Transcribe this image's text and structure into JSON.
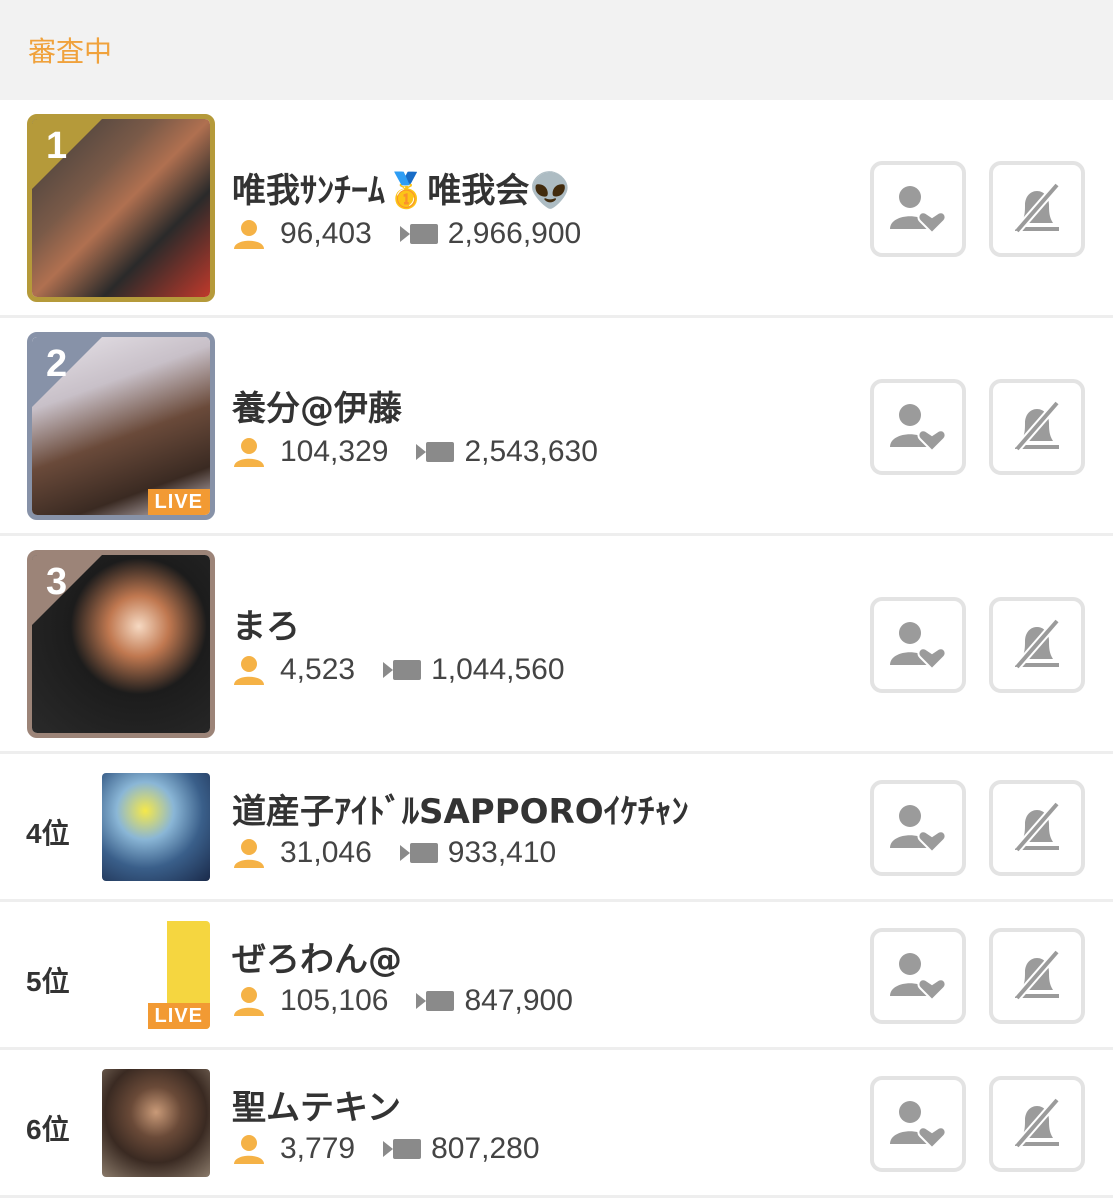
{
  "header": {
    "title": "審査中"
  },
  "colors": {
    "accent": "#f0a23c",
    "gold": "#b59a3a",
    "silver": "#8792a8",
    "bronze": "#9c8478",
    "live": "#f29a33",
    "icon_gray": "#9b9b9b"
  },
  "rows": [
    {
      "rank_badge": "1",
      "rank_label": "",
      "name": "唯我ｻﾝﾁｰﾑ🥇唯我会👽",
      "viewers": "96,403",
      "points": "2,966,900",
      "live": false,
      "live_label": ""
    },
    {
      "rank_badge": "2",
      "rank_label": "",
      "name": "養分@伊藤",
      "viewers": "104,329",
      "points": "2,543,630",
      "live": true,
      "live_label": "LIVE"
    },
    {
      "rank_badge": "3",
      "rank_label": "",
      "name": "まろ",
      "viewers": "4,523",
      "points": "1,044,560",
      "live": false,
      "live_label": ""
    },
    {
      "rank_badge": "",
      "rank_label": "4位",
      "name": "道産子ｱｲﾄﾞﾙSAPPOROｲｹﾁｬﾝ",
      "viewers": "31,046",
      "points": "933,410",
      "live": false,
      "live_label": ""
    },
    {
      "rank_badge": "",
      "rank_label": "5位",
      "name": "ぜろわん@",
      "viewers": "105,106",
      "points": "847,900",
      "live": true,
      "live_label": "LIVE"
    },
    {
      "rank_badge": "",
      "rank_label": "6位",
      "name": "聖ムテキン",
      "viewers": "3,779",
      "points": "807,280",
      "live": false,
      "live_label": ""
    }
  ],
  "icons": {
    "viewer": "person-icon",
    "points": "video-camera-icon",
    "follow": "person-heart-icon",
    "mute": "bell-slash-icon"
  }
}
